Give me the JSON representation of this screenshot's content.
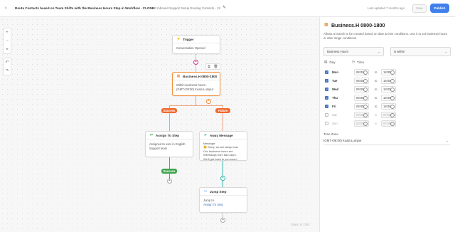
{
  "header": {
    "back_icon": "‹",
    "title": "Route Contacts based on Team Shifts with the Business Hours Step in Workflow - CLONE",
    "subtitle": "KB Inbound Support Setup Routing Contacts - JS",
    "last_updated": "Last updated 7 months ago",
    "save_label": "Save",
    "publish_label": "Publish",
    "publish_color": "#3f80ea"
  },
  "canvas": {
    "zoom_in": "+",
    "zoom_out": "−",
    "fit": "⌖",
    "undo": "↶",
    "redo": "↷",
    "steps_counter": "Steps: 6 / 100",
    "trigger": {
      "title": "Trigger",
      "body": "Conversation Opened"
    },
    "business_hours": {
      "title": "Business.H 0800-1800",
      "body_line1": "Within business hours -",
      "body_line2": "(GMT+08:00) Kuala Lumpur"
    },
    "success_label": "Success",
    "failure_label": "Failure",
    "assign": {
      "title": "Assign To Step",
      "body_line1": "Assigned to user in English",
      "body_line2": "Support team"
    },
    "away": {
      "title": "Away Message",
      "body_line1": "Message:",
      "body_line2": "😊 Sorry, we are away now.",
      "body_line3": "Our business hours are",
      "body_line4": "Weekdays from 8am-6pm.",
      "body_line5": "We'll get back to you soon!"
    },
    "assign_success_label": "Success",
    "jump": {
      "title": "Jump Step",
      "body_line1": "Jump to",
      "body_link": "Assign To Step"
    }
  },
  "panel": {
    "title": "Business.H 0800-1800",
    "description": "Allows a branch to be created based on date & time conditions. Use it to set business hours or date range conditions.",
    "condition_field": "Business Hours",
    "operator": "is within",
    "col_day": "Day",
    "col_time": "Time",
    "to_label": "to",
    "days": [
      {
        "name": "Mon",
        "checked": true,
        "from": "08:00",
        "to": "18:00"
      },
      {
        "name": "Tue",
        "checked": true,
        "from": "08:00",
        "to": "18:00"
      },
      {
        "name": "Wed",
        "checked": true,
        "from": "08:00",
        "to": "18:00"
      },
      {
        "name": "Thu",
        "checked": true,
        "from": "08:00",
        "to": "18:00"
      },
      {
        "name": "Fri",
        "checked": true,
        "from": "08:00",
        "to": "18:00"
      },
      {
        "name": "Sat",
        "checked": false,
        "from": "00:00",
        "to": "07:59"
      },
      {
        "name": "Sun",
        "checked": false,
        "from": "00:00",
        "to": "07:59"
      }
    ],
    "timezone_label": "Time Zone",
    "timezone_value": "(GMT+08:00) Kuala Lumpur"
  }
}
